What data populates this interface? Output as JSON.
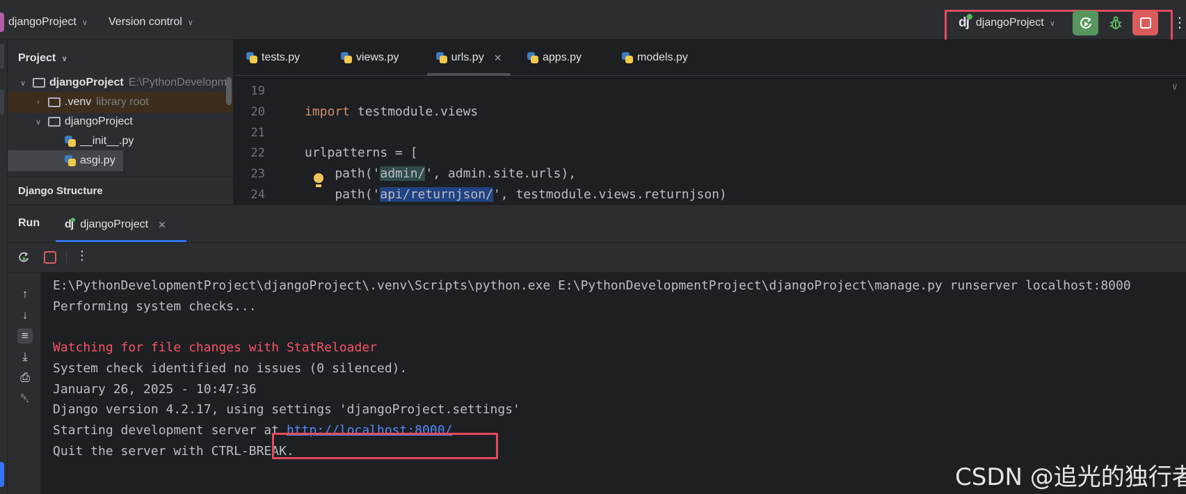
{
  "titlebar": {
    "project_name": "djangoProject",
    "vcs_label": "Version control",
    "run_config": "djangoProject",
    "logo_text": "dj",
    "more_icon": "more-vertical-icon"
  },
  "project_pane": {
    "title": "Project",
    "tree": [
      {
        "label": "djangoProject",
        "hint": "E:\\PythonDevelopm"
      },
      {
        "label": ".venv",
        "hint": "library root"
      },
      {
        "label": "djangoProject",
        "hint": ""
      },
      {
        "label": "__init__.py",
        "hint": ""
      },
      {
        "label": "asgi.py",
        "hint": ""
      }
    ],
    "structure_title": "Django Structure"
  },
  "tabs": [
    {
      "label": "tests.py"
    },
    {
      "label": "views.py"
    },
    {
      "label": "urls.py",
      "close": "✕"
    },
    {
      "label": "apps.py"
    },
    {
      "label": "models.py"
    }
  ],
  "editor": {
    "line_numbers": [
      "19",
      "20",
      "21",
      "22",
      "23",
      "24"
    ],
    "line20_kw": "import",
    "line20_rest": " testmodule.views",
    "line22": "urlpatterns = [",
    "line23_a": "    path('",
    "line23_b": "admin/",
    "line23_c": "', admin.site.urls),",
    "line24_a": "    path('",
    "line24_b": "api/returnjson/",
    "line24_c": "', testmodule.views.returnjson)"
  },
  "run_panel": {
    "title": "Run",
    "tab_label": "djangoProject",
    "tab_close": "✕",
    "more": "⋮"
  },
  "console": {
    "lines": [
      "E:\\PythonDevelopmentProject\\djangoProject\\.venv\\Scripts\\python.exe E:\\PythonDevelopmentProject\\djangoProject\\manage.py runserver localhost:8000",
      "Performing system checks...",
      "",
      "Watching for file changes with StatReloader",
      "System check identified no issues (0 silenced).",
      "January 26, 2025 - 10:47:36",
      "Django version 4.2.17, using settings 'djangoProject.settings'",
      "Starting development server at ",
      "Quit the server with CTRL-BREAK."
    ],
    "server_link": "http://localhost:8000/"
  },
  "watermark": "CSDN @追光的独行者",
  "colors": {
    "accent": "#3574f0",
    "highlight_box": "#e54a5e",
    "run_green": "#57965c",
    "stop_red": "#db5c5c"
  }
}
